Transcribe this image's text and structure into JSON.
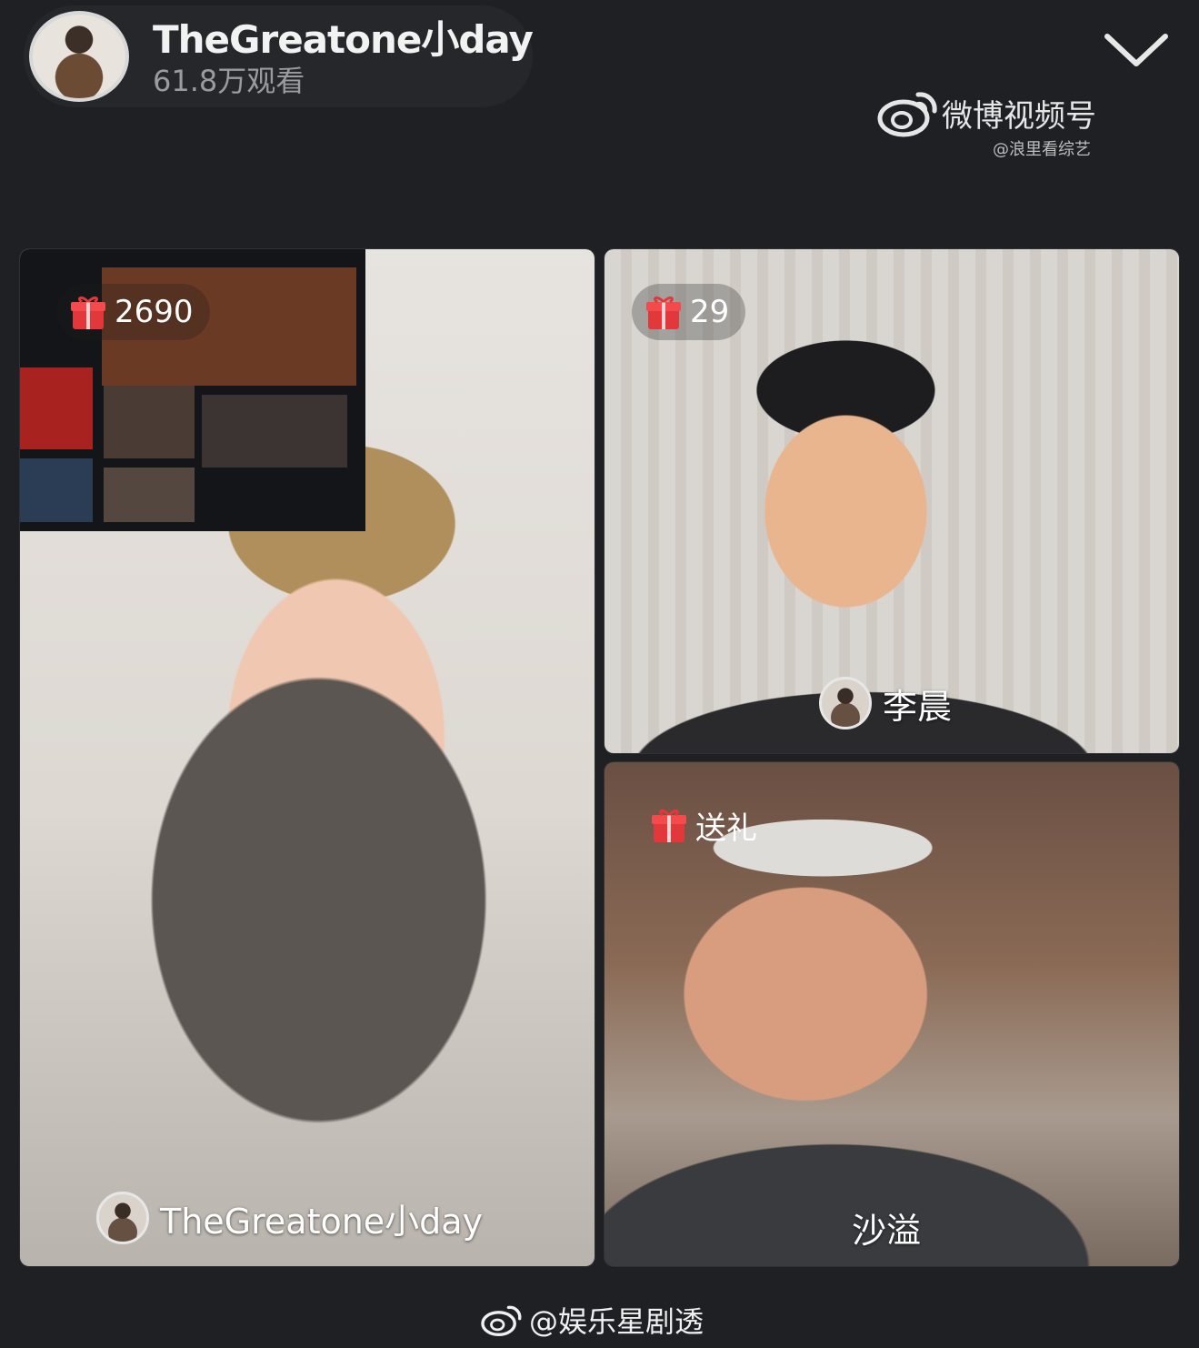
{
  "header": {
    "host_name": "TheGreatone小day",
    "views": "61.8万观看",
    "collapse_icon": "chevron-down-icon",
    "brand": "微博视频号",
    "brand_handle": "@浪里看综艺"
  },
  "tiles": [
    {
      "gift_count": "2690",
      "streamer": "TheGreatone小day"
    },
    {
      "gift_count": "29",
      "streamer": "李晨"
    },
    {
      "gift_count": "送礼",
      "streamer": "沙溢"
    }
  ],
  "footer": {
    "watermark": "@娱乐星剧透"
  },
  "colors": {
    "background": "#1f2023",
    "gift_red": "#e3383b"
  }
}
